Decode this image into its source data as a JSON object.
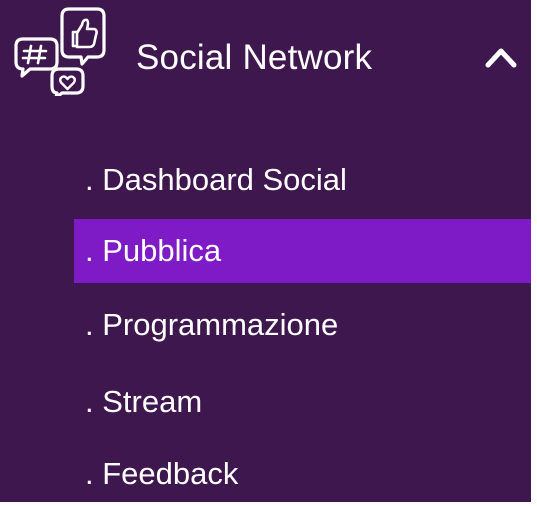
{
  "colors": {
    "background": "#3f174f",
    "active_item": "#7e1bc7",
    "text": "#ffffff"
  },
  "header": {
    "icon": "social-network-icon",
    "title": "Social Network",
    "toggle_icon": "chevron-up-icon",
    "expanded": true
  },
  "menu": {
    "items": [
      {
        "label": ". Dashboard Social",
        "active": false
      },
      {
        "label": ". Pubblica",
        "active": true
      },
      {
        "label": ". Programmazione",
        "active": false
      },
      {
        "label": ". Stream",
        "active": false
      },
      {
        "label": ". Feedback",
        "active": false
      }
    ]
  }
}
